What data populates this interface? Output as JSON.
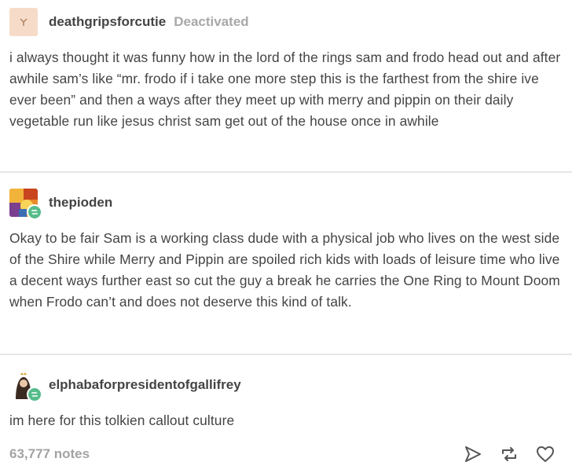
{
  "posts": [
    {
      "username": "deathgripsforcutie",
      "status": "Deactivated",
      "body": "i always thought it was funny how in the lord of the rings sam and frodo head out and after awhile sam’s like “mr. frodo if i take one more step this is the farthest from the shire ive ever been” and then a ways after they meet up with merry and pippin on their daily vegetable run like jesus christ sam get out of the house once in awhile"
    },
    {
      "username": "thepioden",
      "body": "Okay to be fair Sam is a working class dude with a physical job who lives on the west side of the Shire while Merry and Pippin are spoiled rich kids with loads of leisure time who live a decent ways further east so cut the guy a break he carries the One Ring to Mount Doom when Frodo can’t and does not deserve this kind of talk."
    },
    {
      "username": "elphabaforpresidentofgallifrey",
      "body": "im here for this tolkien callout culture"
    }
  ],
  "footer": {
    "notes": "63,777 notes",
    "icons": [
      "share-icon",
      "reblog-icon",
      "like-icon"
    ]
  },
  "colors": {
    "text": "#444444",
    "muted": "#a8a8a8",
    "reblog_green": "#56bc8a",
    "divider": "#e7e7e7"
  }
}
